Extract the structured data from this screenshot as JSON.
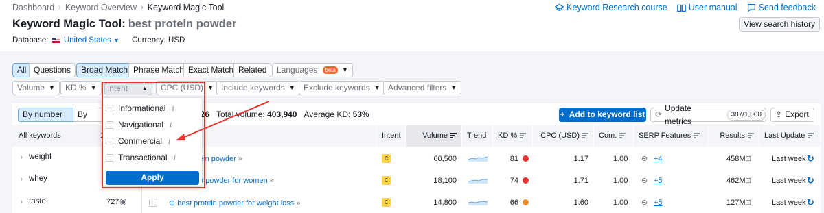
{
  "breadcrumb": [
    "Dashboard",
    "Keyword Overview",
    "Keyword Magic Tool"
  ],
  "toplinks": {
    "course": "Keyword Research course",
    "manual": "User manual",
    "feedback": "Send feedback"
  },
  "title": {
    "tool": "Keyword Magic Tool:",
    "query": "best protein powder"
  },
  "view_history": "View search history",
  "database": {
    "label": "Database:",
    "value": "United States",
    "currency": "Currency: USD"
  },
  "filters_row1": {
    "all": "All",
    "questions": "Questions",
    "broad": "Broad Match",
    "phrase": "Phrase Match",
    "exact": "Exact Match",
    "related": "Related",
    "languages": "Languages",
    "beta": "beta"
  },
  "filters_row2": {
    "volume": "Volume",
    "kd": "KD %",
    "intent": "Intent",
    "cpc": "CPC (USD)",
    "include": "Include keywords",
    "exclude": "Exclude keywords",
    "advanced": "Advanced filters"
  },
  "summary": {
    "by_number": "By number",
    "by_volume": "By volume",
    "total_count": "026",
    "total_volume_label": "Total volume:",
    "total_volume": "403,940",
    "avg_kd_label": "Average KD:",
    "avg_kd": "53%",
    "add_btn": "Add to keyword list",
    "update_btn": "Update metrics",
    "update_count": "387/1,000",
    "export": "Export"
  },
  "left": {
    "header": "All keywords",
    "header_count": "1",
    "items": [
      {
        "label": "weight",
        "count": ""
      },
      {
        "label": "whey",
        "count": ""
      },
      {
        "label": "taste",
        "count": "727"
      }
    ]
  },
  "columns": [
    "Intent",
    "Volume",
    "Trend",
    "KD %",
    "CPC (USD)",
    "Com.",
    "SERP Features",
    "Results",
    "Last Update"
  ],
  "rows": [
    {
      "keyword": "ein powder",
      "intent": "C",
      "volume": "60,500",
      "kd": "81",
      "kd_color": "#e8322b",
      "cpc": "1.17",
      "com": "1.00",
      "serp": "+4",
      "results": "458M",
      "updated": "Last week"
    },
    {
      "keyword": "n powder for women",
      "intent": "C",
      "volume": "18,100",
      "kd": "74",
      "kd_color": "#e8322b",
      "cpc": "1.71",
      "com": "1.00",
      "serp": "+5",
      "results": "462M",
      "updated": "Last week"
    },
    {
      "keyword": "best protein powder for weight loss",
      "intent": "C",
      "volume": "14,800",
      "kd": "66",
      "kd_color": "#f08c2d",
      "cpc": "1.60",
      "com": "1.00",
      "serp": "+5",
      "results": "127M",
      "updated": "Last week"
    }
  ],
  "intent_menu": {
    "options": [
      "Informational",
      "Navigational",
      "Commercial",
      "Transactional"
    ],
    "apply": "Apply"
  },
  "colors": {
    "accent": "#006dca",
    "highlight": "#e8322b",
    "intent_badge": "#fcd34d"
  }
}
